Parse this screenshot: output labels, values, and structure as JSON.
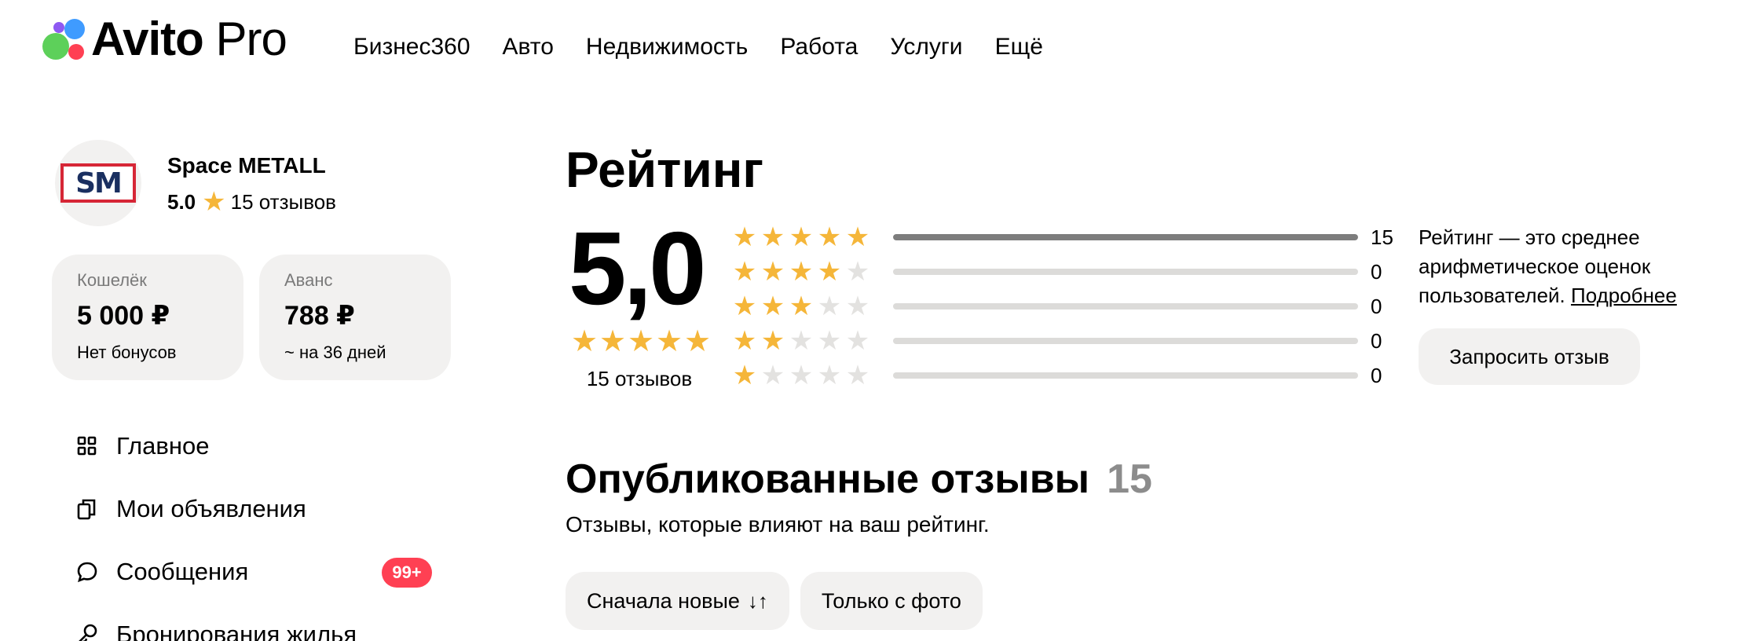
{
  "header": {
    "logo_bold": "Avito",
    "logo_light": "Pro",
    "nav": [
      "Бизнес360",
      "Авто",
      "Недвижимость",
      "Работа",
      "Услуги",
      "Ещё"
    ]
  },
  "profile": {
    "avatar_text": "SM",
    "name": "Space METALL",
    "score": "5.0",
    "reviews": "15 отзывов"
  },
  "wallet": {
    "label": "Кошелёк",
    "value": "5 000 ₽",
    "sub": "Нет бонусов"
  },
  "advance": {
    "label": "Аванс",
    "value": "788 ₽",
    "sub": "~ на 36 дней"
  },
  "menu": [
    {
      "label": "Главное",
      "icon": "grid-icon"
    },
    {
      "label": "Мои объявления",
      "icon": "copy-icon"
    },
    {
      "label": "Сообщения",
      "icon": "chat-bubble-icon",
      "badge": "99+"
    },
    {
      "label": "Бронирования жилья",
      "icon": "key-icon"
    }
  ],
  "rating": {
    "title": "Рейтинг",
    "score": "5,0",
    "stars": 5,
    "count_label": "15 отзывов",
    "rows": [
      {
        "stars": 5,
        "count": "15",
        "fraction": 1.0
      },
      {
        "stars": 4,
        "count": "0",
        "fraction": 0
      },
      {
        "stars": 3,
        "count": "0",
        "fraction": 0
      },
      {
        "stars": 2,
        "count": "0",
        "fraction": 0
      },
      {
        "stars": 1,
        "count": "0",
        "fraction": 0
      }
    ],
    "note": "Рейтинг — это среднее арифметическое оценок пользователей.",
    "note_link": "Подробнее",
    "request_button": "Запросить отзыв"
  },
  "published": {
    "title": "Опубликованные отзывы",
    "count": "15",
    "subtitle": "Отзывы, которые влияют на ваш рейтинг."
  },
  "filters": {
    "sort_label": "Сначала новые",
    "photo_label": "Только с фото"
  },
  "colors": {
    "star": "#f5b639",
    "badge": "#ff4053",
    "card_bg": "#f2f1f0"
  }
}
